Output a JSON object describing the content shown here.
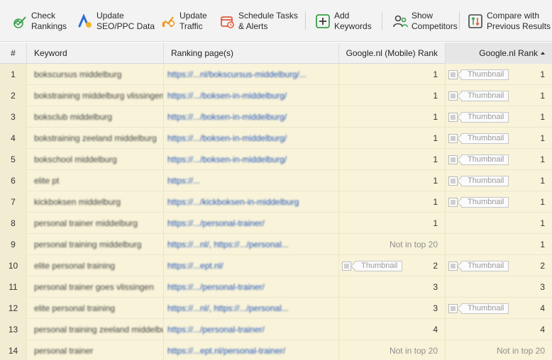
{
  "toolbar": {
    "check": "Check\nRankings",
    "update_seo": "Update\nSEO/PPC Data",
    "update_traffic": "Update\nTraffic",
    "schedule": "Schedule Tasks\n& Alerts",
    "add_kw": "Add\nKeywords",
    "competitors": "Show\nCompetitors",
    "compare": "Compare with\nPrevious Results"
  },
  "table": {
    "headers": {
      "num": "#",
      "keyword": "Keyword",
      "page": "Ranking page(s)",
      "mobile": "Google.nl (Mobile) Rank",
      "rank": "Google.nl Rank"
    },
    "thumbnail_label": "Thumbnail",
    "rows": [
      {
        "n": "1",
        "kw": "bokscursus middelburg",
        "url": "https://...nl/bokscursus-middelburg/...",
        "mobile": "1",
        "rank": "1"
      },
      {
        "n": "2",
        "kw": "bokstraining middelburg vlissingen",
        "url": "https://.../boksen-in-middelburg/",
        "mobile": "1",
        "rank": "1"
      },
      {
        "n": "3",
        "kw": "boksclub middelburg",
        "url": "https://.../boksen-in-middelburg/",
        "mobile": "1",
        "rank": "1"
      },
      {
        "n": "4",
        "kw": "bokstraining zeeland middelburg",
        "url": "https://.../boksen-in-middelburg/",
        "mobile": "1",
        "rank": "1"
      },
      {
        "n": "5",
        "kw": "bokschool middelburg",
        "url": "https://.../boksen-in-middelburg/",
        "mobile": "1",
        "rank": "1"
      },
      {
        "n": "6",
        "kw": "elite pt",
        "url": "https://...",
        "mobile": "1",
        "rank": "1"
      },
      {
        "n": "7",
        "kw": "kickboksen middelburg",
        "url": "https://.../kickboksen-in-middelburg",
        "mobile": "1",
        "rank": "1"
      },
      {
        "n": "8",
        "kw": "personal trainer middelburg",
        "url": "https://.../personal-trainer/",
        "mobile": "1",
        "rank": "1"
      },
      {
        "n": "9",
        "kw": "personal training middelburg",
        "url": "https://...nl/, https://.../personal...",
        "mobile": "Not in top 20",
        "rank": "1"
      },
      {
        "n": "10",
        "kw": "elite personal training",
        "url": "https://...ept.nl/",
        "mobile": "2",
        "rank": "2"
      },
      {
        "n": "11",
        "kw": "personal trainer goes vlissingen",
        "url": "https://.../personal-trainer/",
        "mobile": "3",
        "rank": "3"
      },
      {
        "n": "12",
        "kw": "elite personal training",
        "url": "https://...nl/, https://.../personal...",
        "mobile": "3",
        "rank": "4"
      },
      {
        "n": "13",
        "kw": "personal training zeeland middelburg",
        "url": "https://.../personal-trainer/",
        "mobile": "4",
        "rank": "4"
      },
      {
        "n": "14",
        "kw": "personal trainer",
        "url": "https://...ept.nl/personal-trainer/",
        "mobile": "Not in top 20",
        "rank": "Not in top 20"
      }
    ]
  },
  "thumbs": {
    "mobile": [
      false,
      false,
      false,
      false,
      false,
      false,
      false,
      false,
      false,
      true,
      false,
      false,
      false,
      false
    ],
    "rank": [
      true,
      true,
      true,
      true,
      true,
      true,
      true,
      false,
      false,
      true,
      false,
      true,
      false,
      false
    ]
  }
}
